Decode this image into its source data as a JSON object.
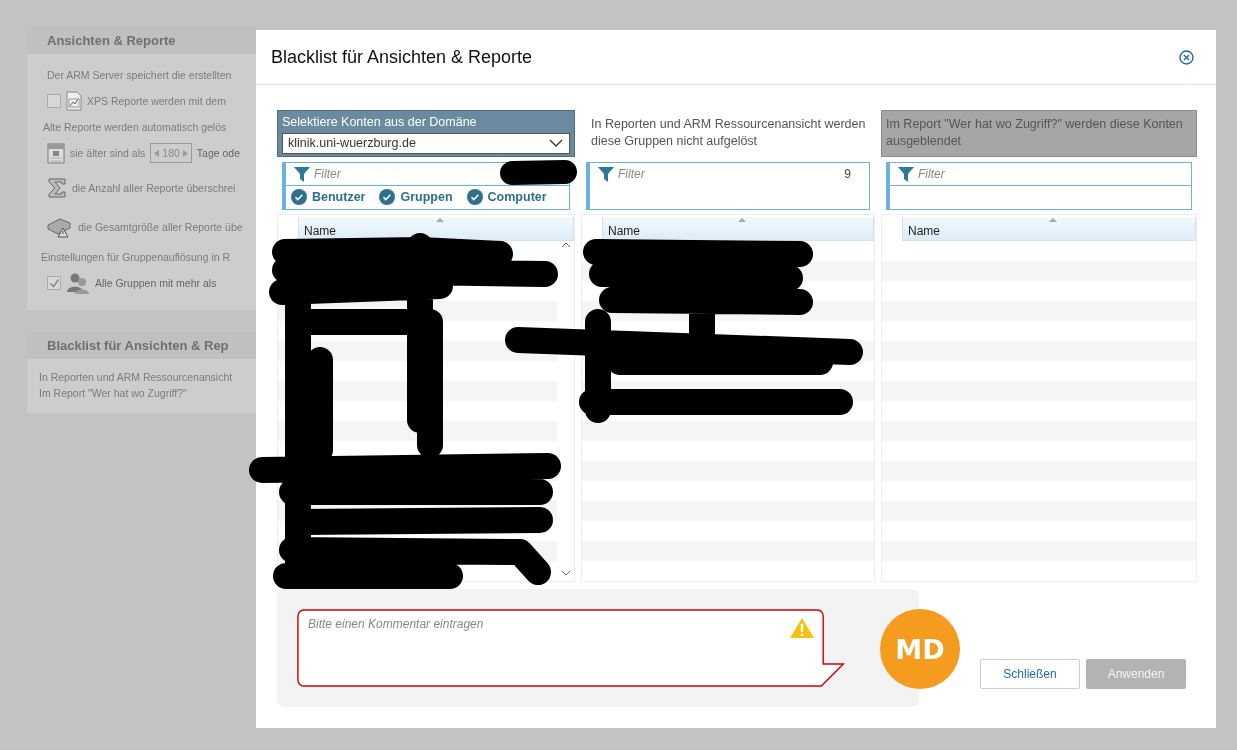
{
  "background": {
    "settings": {
      "title": "Ansichten & Reporte",
      "intro": "Der ARM Server speichert die erstellten",
      "xps": {
        "checked": false,
        "label": "XPS Reporte werden mit dem"
      },
      "cleanup_note": "Alte Reporte werden automatisch gelös",
      "age": {
        "label": "sie älter sind als",
        "value": "180",
        "unit": "Tage ode"
      },
      "count": {
        "label": "die Anzahl aller Reporte überschrei"
      },
      "size": {
        "label": "die Gesamtgröße aller Reporte übe"
      },
      "group_note": "Einstellungen für Gruppenauflösung in R",
      "groups": {
        "checked": true,
        "label": "Alle Gruppen mit mehr als"
      }
    },
    "blacklist": {
      "title": "Blacklist für Ansichten & Rep",
      "lines": [
        "In Reporten und ARM Ressourcenansicht",
        "Im Report \"Wer hat wo Zugriff?\""
      ]
    }
  },
  "dialog": {
    "title": "Blacklist für Ansichten & Reporte",
    "columns": [
      {
        "kind": "domain",
        "header": "Selektiere Konten aus der Domäne",
        "domain": "klinik.uni-wuerzburg.de",
        "filter": {
          "placeholder": "Filter"
        },
        "toggles": [
          {
            "label": "Benutzer",
            "checked": true
          },
          {
            "label": "Gruppen",
            "checked": true
          },
          {
            "label": "Computer",
            "checked": true
          }
        ],
        "grid": {
          "column": "Name"
        }
      },
      {
        "kind": "note",
        "header": "In Reporten und ARM Ressourcenansicht werden diese Gruppen nicht aufgelöst",
        "filter": {
          "placeholder": "Filter",
          "count": "9"
        },
        "grid": {
          "column": "Name"
        }
      },
      {
        "kind": "muted",
        "header": "Im Report \"Wer hat wo Zugriff?\" werden diese Konten ausgeblendet",
        "filter": {
          "placeholder": "Filter"
        },
        "grid": {
          "column": "Name"
        }
      }
    ],
    "comment": {
      "placeholder": "Bitte einen Kommentar eintragen",
      "invalid": true
    },
    "avatar": {
      "initials": "MD"
    },
    "buttons": [
      {
        "label": "Schließen",
        "disabled": false
      },
      {
        "label": "Anwenden",
        "disabled": true
      }
    ]
  }
}
